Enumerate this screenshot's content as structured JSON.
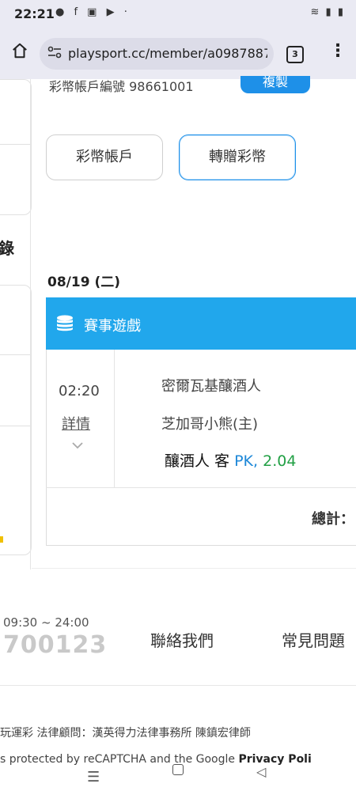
{
  "status_bar": {
    "time": "22:21",
    "left_icons": "● f ▣ ▶ ·",
    "right_icons": "≋ ▮ ▮"
  },
  "browser": {
    "home_icon": "home-icon",
    "url_prefix_icon": "tune-icon",
    "url": "playsport.cc/member/a09878872",
    "tab_count": "3",
    "menu_icon": "⋮"
  },
  "page": {
    "cut_text": "彩幣帳戶編號 98661001",
    "cut_button": "複製",
    "left_tab_label": "錄",
    "buttons": {
      "lottery_account": "彩幣帳戶",
      "transfer": "轉贈彩幣"
    },
    "date": "08/19 (二)",
    "game_section": {
      "title": "賽事遊戲",
      "time": "02:20",
      "detail": "詳情",
      "chevron": "⌄",
      "team_away": "密爾瓦基釀酒人",
      "team_home": "芝加哥小熊(主)",
      "bet_pick": "釀酒人 客",
      "bet_type": "PK,",
      "bet_odds": "2.04",
      "total_label": "總計："
    }
  },
  "footer": {
    "hours": "09:30 ~ 24:00",
    "phone": "700123",
    "contact": "聯絡我們",
    "faq": "常見問題",
    "legal": "玩運彩 法律顧問：漢英得力法律事務所 陳鎮宏律師",
    "recaptcha_prefix": "s protected by reCAPTCHA and the Google ",
    "recaptcha_link": "Privacy Poli"
  },
  "nav": {
    "menu": "☰",
    "back": "◁"
  },
  "colors": {
    "accent": "#1e90e8",
    "header_blue": "#21a7ec",
    "pk_blue": "#1e88d8",
    "odds_green": "#22a045"
  }
}
